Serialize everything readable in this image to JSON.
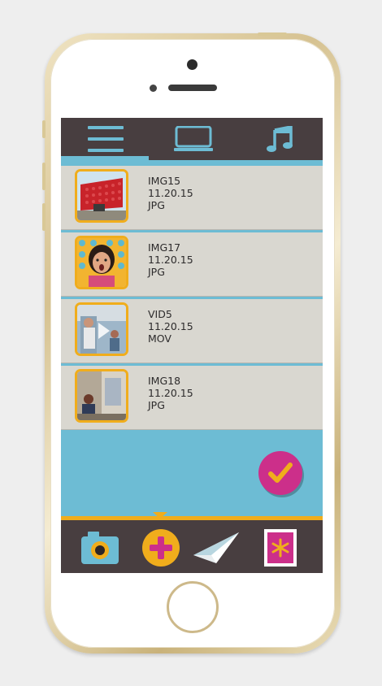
{
  "colors": {
    "topbar": "#483e40",
    "accent_blue": "#6dbcd4",
    "accent_orange": "#f0ad1c",
    "accent_magenta": "#cc2f8a",
    "row_bg": "#d9d7d0"
  },
  "top_tabs": [
    {
      "name": "list-view",
      "icon": "hamburger-icon",
      "active": true
    },
    {
      "name": "slideshow-view",
      "icon": "monitor-icon",
      "active": false
    },
    {
      "name": "music",
      "icon": "music-note-icon",
      "active": false
    }
  ],
  "media_items": [
    {
      "name": "IMG15",
      "date": "11.20.15",
      "type": "JPG",
      "thumb": "red-building-photo"
    },
    {
      "name": "IMG17",
      "date": "11.20.15",
      "type": "JPG",
      "thumb": "surprised-child-photo"
    },
    {
      "name": "VID5",
      "date": "11.20.15",
      "type": "MOV",
      "thumb": "video-thumbnail"
    },
    {
      "name": "IMG18",
      "date": "11.20.15",
      "type": "JPG",
      "thumb": "room-photo"
    }
  ],
  "fab": {
    "icon": "checkmark-icon"
  },
  "bottom_nav": [
    {
      "name": "camera",
      "icon": "camera-icon"
    },
    {
      "name": "add",
      "icon": "plus-icon",
      "active": true
    },
    {
      "name": "send",
      "icon": "paper-plane-icon"
    },
    {
      "name": "stamp",
      "icon": "stamp-icon"
    }
  ]
}
